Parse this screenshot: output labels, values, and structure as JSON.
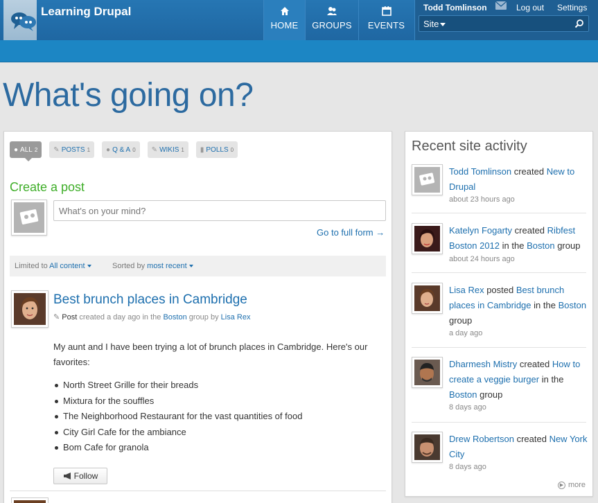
{
  "header": {
    "site_name": "Learning Drupal",
    "nav": [
      {
        "label": "HOME",
        "icon": "home-icon"
      },
      {
        "label": "GROUPS",
        "icon": "groups-icon"
      },
      {
        "label": "EVENTS",
        "icon": "calendar-icon"
      }
    ],
    "user_name": "Todd Tomlinson",
    "logout_label": "Log out",
    "settings_label": "Settings",
    "search_scope": "Site",
    "accent_color": "#1f67a2"
  },
  "page_title": "What's going on?",
  "filters": [
    {
      "label": "ALL",
      "count": "2",
      "icon": "speech-bubble-icon",
      "active": true
    },
    {
      "label": "POSTS",
      "count": "1",
      "icon": "pencil-icon"
    },
    {
      "label": "Q & A",
      "count": "0",
      "icon": "people-icon"
    },
    {
      "label": "WIKIS",
      "count": "1",
      "icon": "edit-icon"
    },
    {
      "label": "POLLS",
      "count": "0",
      "icon": "bar-chart-icon"
    }
  ],
  "create_post": {
    "title": "Create a post",
    "placeholder": "What's on your mind?",
    "full_form_link": "Go to full form →"
  },
  "sort_bar": {
    "limited_label": "Limited to",
    "limited_value": "All content",
    "sorted_label": "Sorted by",
    "sorted_value": "most recent"
  },
  "post": {
    "title": "Best brunch places in Cambridge",
    "type": "Post",
    "created_text": "created a day ago in the",
    "group": "Boston",
    "group_by": "group by",
    "author": "Lisa Rex",
    "body": "My aunt and I have been trying a lot of brunch places in Cambridge. Here's our favorites:",
    "list": [
      "North Street Grille for their breads",
      "Mixtura for the souffles",
      "The Neighborhood Restaurant for the vast quantities of food",
      "City Girl Cafe for the ambiance",
      "Bom Cafe for granola"
    ],
    "follow_label": "Follow"
  },
  "sidebar": {
    "title": "Recent site activity",
    "more_label": "more",
    "items": [
      {
        "user": "Todd Tomlinson",
        "verb": "created",
        "link": "New to Drupal",
        "time": "about 23 hours ago"
      },
      {
        "user": "Katelyn Fogarty",
        "verb": "created",
        "link": "Ribfest Boston 2012",
        "in": "in the",
        "group": "Boston",
        "group_word": "group",
        "time": "about 24 hours ago"
      },
      {
        "user": "Lisa Rex",
        "verb": "posted",
        "link": "Best brunch places in Cambridge",
        "in": "in the",
        "group": "Boston",
        "group_word": "group",
        "time": "a day ago"
      },
      {
        "user": "Dharmesh Mistry",
        "verb": "created",
        "link": "How to create a veggie burger",
        "in": "in the",
        "group": "Boston",
        "group_word": "group",
        "time": "8 days ago"
      },
      {
        "user": "Drew Robertson",
        "verb": "created",
        "link": "New York City",
        "time": "8 days ago"
      }
    ]
  }
}
